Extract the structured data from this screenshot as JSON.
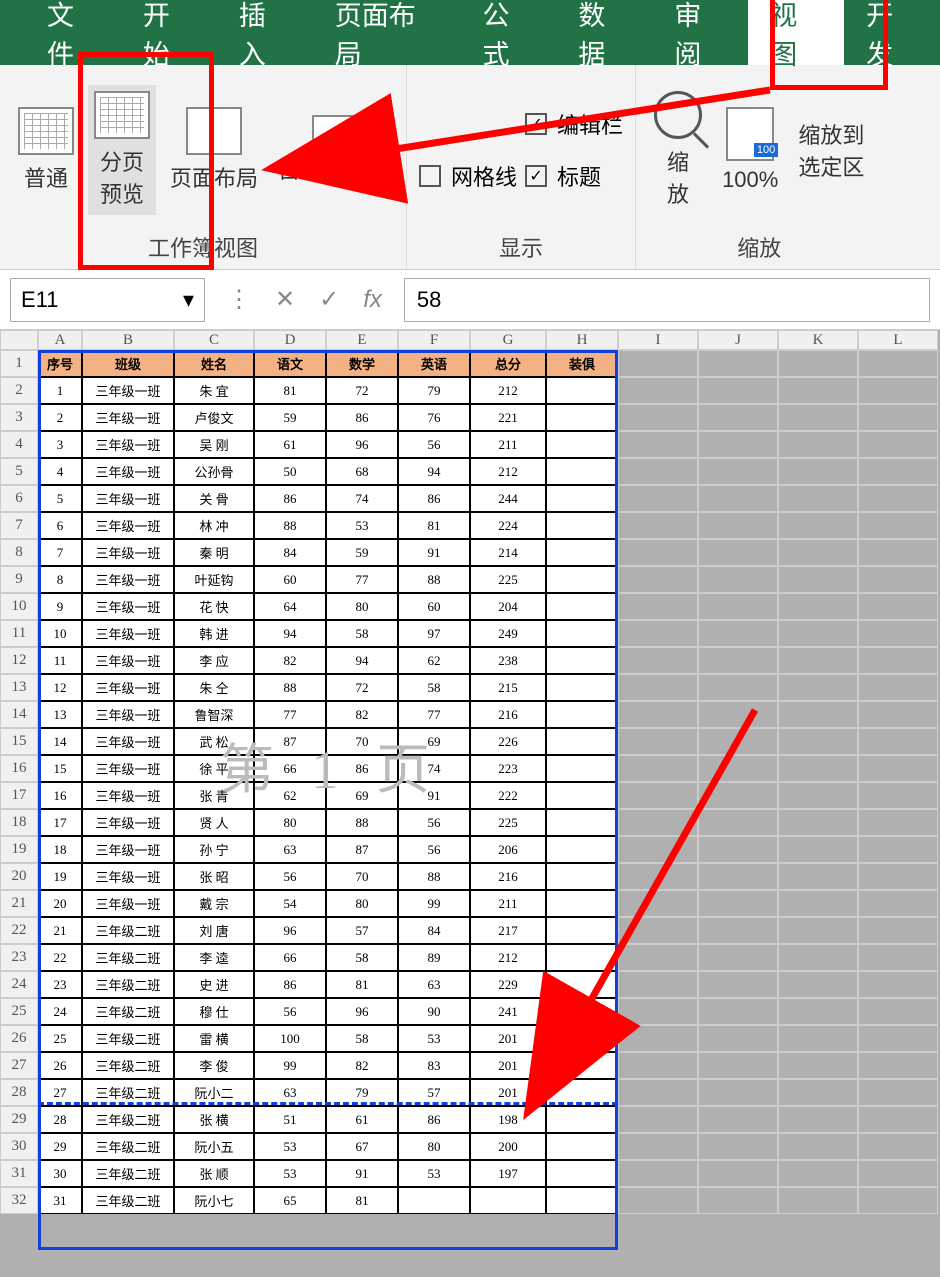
{
  "tabs": {
    "file": "文件",
    "home": "开始",
    "insert": "插入",
    "layout": "页面布局",
    "formula": "公式",
    "data": "数据",
    "review": "审阅",
    "view": "视图",
    "dev": "开发"
  },
  "ribbon": {
    "normal": "普通",
    "pagebreak": "分页\n预览",
    "pagelayout": "页面布局",
    "custom": "自定义视图",
    "formulabar": "编辑栏",
    "grid": "网格线",
    "heading": "标题",
    "zoom": "缩\n放",
    "pct": "100%",
    "zoomsel": "缩放到\n选定区",
    "group_workbook": "工作簿视图",
    "group_show": "显示",
    "group_zoom": "缩放",
    "badge": "100"
  },
  "formulaBar": {
    "name": "E11",
    "fx": "fx",
    "value": "58"
  },
  "colLabels": [
    "A",
    "B",
    "C",
    "D",
    "E",
    "F",
    "G",
    "H",
    "I",
    "J",
    "K",
    "L"
  ],
  "rowCount": 32,
  "watermark": "第 1 页",
  "headers": [
    "序号",
    "班级",
    "姓名",
    "语文",
    "数学",
    "英语",
    "总分",
    "装俱"
  ],
  "rows": [
    [
      "1",
      "三年级一班",
      "朱 宜",
      "81",
      "72",
      "79",
      "212",
      ""
    ],
    [
      "2",
      "三年级一班",
      "卢俊文",
      "59",
      "86",
      "76",
      "221",
      ""
    ],
    [
      "3",
      "三年级一班",
      "吴 刚",
      "61",
      "96",
      "56",
      "211",
      ""
    ],
    [
      "4",
      "三年级一班",
      "公孙骨",
      "50",
      "68",
      "94",
      "212",
      ""
    ],
    [
      "5",
      "三年级一班",
      "关 骨",
      "86",
      "74",
      "86",
      "244",
      ""
    ],
    [
      "6",
      "三年级一班",
      "林 冲",
      "88",
      "53",
      "81",
      "224",
      ""
    ],
    [
      "7",
      "三年级一班",
      "秦 明",
      "84",
      "59",
      "91",
      "214",
      ""
    ],
    [
      "8",
      "三年级一班",
      "叶延钩",
      "60",
      "77",
      "88",
      "225",
      ""
    ],
    [
      "9",
      "三年级一班",
      "花 快",
      "64",
      "80",
      "60",
      "204",
      ""
    ],
    [
      "10",
      "三年级一班",
      "韩 进",
      "94",
      "58",
      "97",
      "249",
      ""
    ],
    [
      "11",
      "三年级一班",
      "李 应",
      "82",
      "94",
      "62",
      "238",
      ""
    ],
    [
      "12",
      "三年级一班",
      "朱 仝",
      "88",
      "72",
      "58",
      "215",
      ""
    ],
    [
      "13",
      "三年级一班",
      "鲁智深",
      "77",
      "82",
      "77",
      "216",
      ""
    ],
    [
      "14",
      "三年级一班",
      "武 松",
      "87",
      "70",
      "69",
      "226",
      ""
    ],
    [
      "15",
      "三年级一班",
      "徐 平",
      "66",
      "86",
      "74",
      "223",
      ""
    ],
    [
      "16",
      "三年级一班",
      "张 青",
      "62",
      "69",
      "91",
      "222",
      ""
    ],
    [
      "17",
      "三年级一班",
      "贤 人",
      "80",
      "88",
      "56",
      "225",
      ""
    ],
    [
      "18",
      "三年级一班",
      "孙 宁",
      "63",
      "87",
      "56",
      "206",
      ""
    ],
    [
      "19",
      "三年级一班",
      "张 昭",
      "56",
      "70",
      "88",
      "216",
      ""
    ],
    [
      "20",
      "三年级一班",
      "戴 宗",
      "54",
      "80",
      "99",
      "211",
      ""
    ],
    [
      "21",
      "三年级二班",
      "刘 唐",
      "96",
      "57",
      "84",
      "217",
      ""
    ],
    [
      "22",
      "三年级二班",
      "李 逵",
      "66",
      "58",
      "89",
      "212",
      ""
    ],
    [
      "23",
      "三年级二班",
      "史 进",
      "86",
      "81",
      "63",
      "229",
      ""
    ],
    [
      "24",
      "三年级二班",
      "穆 仕",
      "56",
      "96",
      "90",
      "241",
      ""
    ],
    [
      "25",
      "三年级二班",
      "雷 横",
      "100",
      "58",
      "53",
      "201",
      ""
    ],
    [
      "26",
      "三年级二班",
      "李 俊",
      "99",
      "82",
      "83",
      "201",
      ""
    ],
    [
      "27",
      "三年级二班",
      "阮小二",
      "63",
      "79",
      "57",
      "201",
      ""
    ],
    [
      "28",
      "三年级二班",
      "张 横",
      "51",
      "61",
      "86",
      "198",
      ""
    ],
    [
      "29",
      "三年级二班",
      "阮小五",
      "53",
      "67",
      "80",
      "200",
      ""
    ],
    [
      "30",
      "三年级二班",
      "张 顺",
      "53",
      "91",
      "53",
      "197",
      ""
    ],
    [
      "31",
      "三年级二班",
      "阮小七",
      "65",
      "81",
      ""
    ]
  ]
}
